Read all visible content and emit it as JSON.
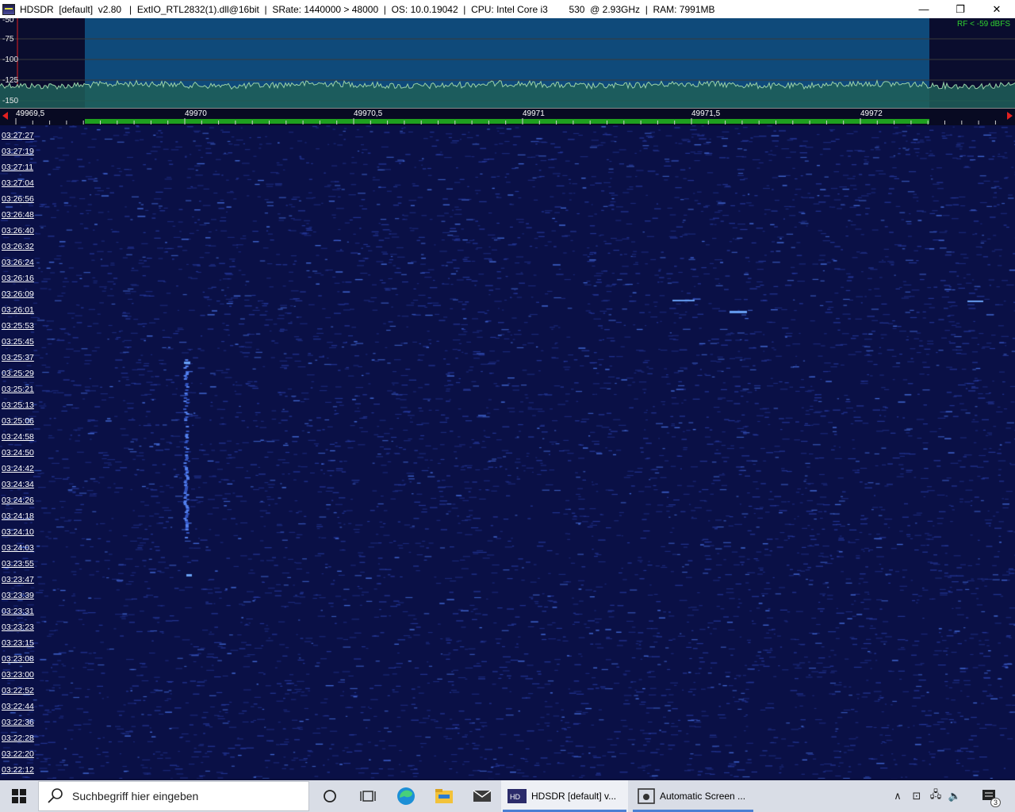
{
  "window": {
    "title": "HDSDR  [default]  v2.80   |  ExtIO_RTL2832(1).dll@16bit  |  SRate: 1440000 > 48000  |  OS: 10.0.19042  |  CPU: Intel Core i3        530  @ 2.93GHz  |  RAM: 7991MB",
    "controls": {
      "minimize": "—",
      "restore": "❐",
      "close": "✕"
    }
  },
  "spectrum": {
    "db_labels": [
      "-50",
      "-75",
      "-100",
      "-125",
      "-150"
    ],
    "rf_status": "RF < -59 dBFS"
  },
  "frequency_scale": {
    "labels": [
      "49969,5",
      "49970",
      "49970,5",
      "49971",
      "49971,5",
      "49972"
    ]
  },
  "waterfall": {
    "timestamps": [
      "03:27:27",
      "03:27:19",
      "03:27:11",
      "03:27:04",
      "03:26:56",
      "03:26:48",
      "03:26:40",
      "03:26:32",
      "03:26:24",
      "03:26:16",
      "03:26:09",
      "03:26:01",
      "03:25:53",
      "03:25:45",
      "03:25:37",
      "03:25:29",
      "03:25:21",
      "03:25:13",
      "03:25:06",
      "03:24:58",
      "03:24:50",
      "03:24:42",
      "03:24:34",
      "03:24:26",
      "03:24:18",
      "03:24:10",
      "03:24:03",
      "03:23:55",
      "03:23:47",
      "03:23:39",
      "03:23:31",
      "03:23:23",
      "03:23:15",
      "03:23:08",
      "03:23:00",
      "03:22:52",
      "03:22:44",
      "03:22:36",
      "03:22:28",
      "03:22:20",
      "03:22:12"
    ]
  },
  "taskbar": {
    "search_placeholder": "Suchbegriff hier eingeben",
    "apps": [
      {
        "label": "HDSDR  [default]  v...",
        "active": true
      },
      {
        "label": "Automatic Screen ...",
        "active": false
      }
    ],
    "notification_count": "3"
  }
}
